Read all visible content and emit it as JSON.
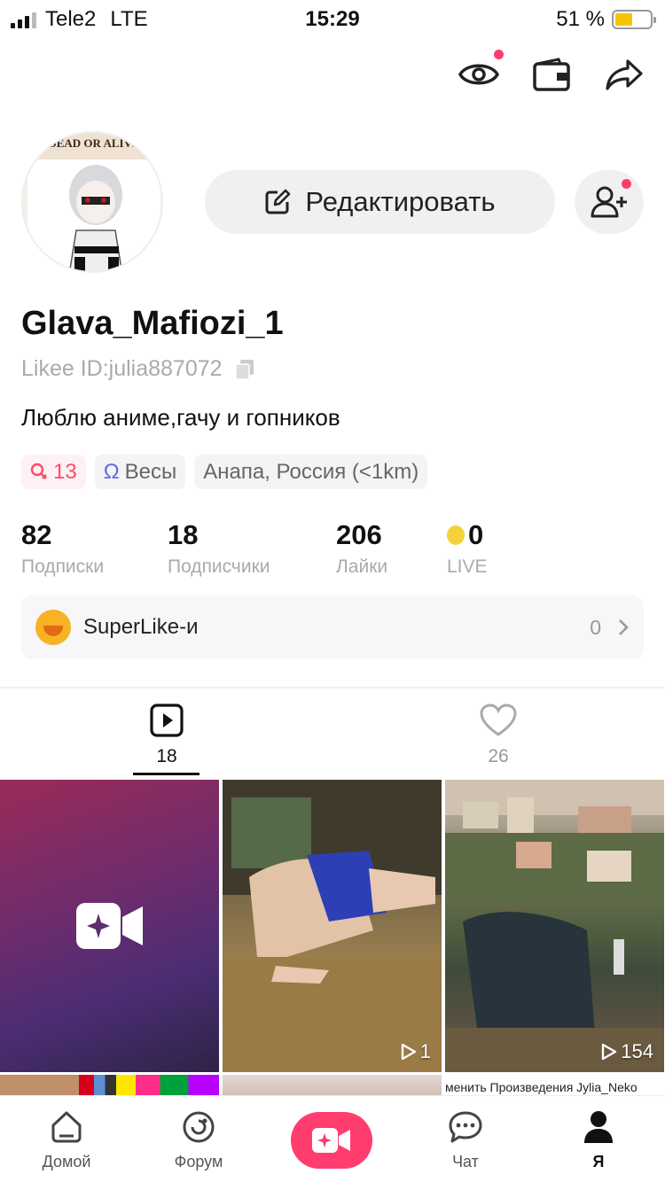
{
  "status_bar": {
    "carrier": "Tele2",
    "network": "LTE",
    "time": "15:29",
    "battery": "51 %"
  },
  "top_actions": [
    "eye-icon",
    "wallet-icon",
    "share-icon"
  ],
  "profile": {
    "avatar_text": "DEAD OR ALIVE",
    "edit_label": "Редактировать",
    "username": "Glava_Mafiozi_1",
    "likee_id": "Likee ID:julia887072",
    "bio": "Люблю аниме,гачу и гопников"
  },
  "chips": {
    "gender_age": "13",
    "zodiac": "Весы",
    "location": "Анапа, Россия (<1km)"
  },
  "stats": {
    "following": {
      "value": "82",
      "label": "Подписки"
    },
    "followers": {
      "value": "18",
      "label": "Подписчики"
    },
    "likes": {
      "value": "206",
      "label": "Лайки"
    },
    "live": {
      "value": "0",
      "label": "LIVE"
    }
  },
  "superlike": {
    "label": "SuperLike-и",
    "count": "0"
  },
  "tabs": {
    "videos_count": "18",
    "liked_count": "26"
  },
  "grid": {
    "video2_views": "1",
    "video3_views": "154",
    "row2_caption": "менить  Произведения Jylia_Neko"
  },
  "bottom_nav": {
    "home": "Домой",
    "forum": "Форум",
    "chat": "Чат",
    "me": "Я"
  },
  "colors": {
    "accent": "#ff3d6e",
    "badge": "#ff3c6f"
  }
}
